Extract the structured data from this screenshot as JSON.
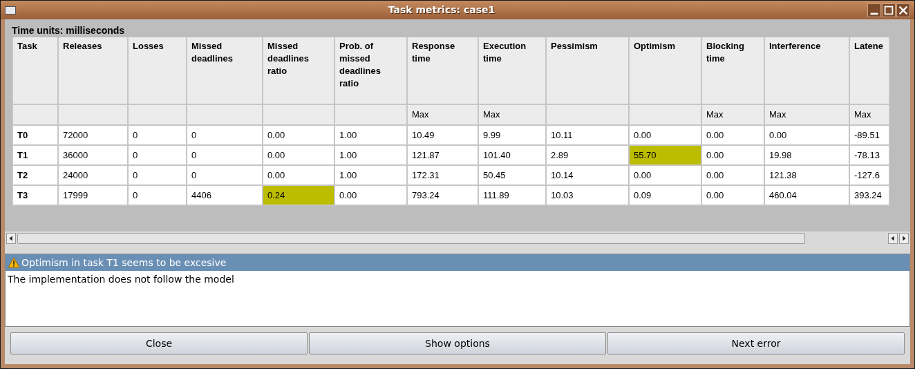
{
  "window": {
    "title": "Task metrics: case1"
  },
  "time_units": "Time units: milliseconds",
  "table": {
    "columns": [
      {
        "label": "Task"
      },
      {
        "label": "Releases"
      },
      {
        "label": "Losses"
      },
      {
        "label": "Missed deadlines"
      },
      {
        "label": "Missed deadlines ratio"
      },
      {
        "label": "Prob. of missed deadlines ratio"
      },
      {
        "label": "Response time",
        "sub": "Max"
      },
      {
        "label": "Execution time",
        "sub": "Max"
      },
      {
        "label": "Pessimism"
      },
      {
        "label": "Optimism"
      },
      {
        "label": "Blocking time",
        "sub": "Max"
      },
      {
        "label": "Interference",
        "sub": "Max"
      },
      {
        "label": "Latene",
        "sub": "Max"
      }
    ],
    "rows": [
      {
        "cells": [
          {
            "text": "T0",
            "highlighted": false
          },
          {
            "text": "72000",
            "highlighted": false
          },
          {
            "text": "0",
            "highlighted": false
          },
          {
            "text": "0",
            "highlighted": false
          },
          {
            "text": "0.00",
            "highlighted": false
          },
          {
            "text": "1.00",
            "highlighted": false
          },
          {
            "text": "10.49",
            "highlighted": false
          },
          {
            "text": "9.99",
            "highlighted": false
          },
          {
            "text": "10.11",
            "highlighted": false
          },
          {
            "text": "0.00",
            "highlighted": false
          },
          {
            "text": "0.00",
            "highlighted": false
          },
          {
            "text": "0.00",
            "highlighted": false
          },
          {
            "text": "-89.51",
            "highlighted": false
          }
        ]
      },
      {
        "cells": [
          {
            "text": "T1",
            "highlighted": false
          },
          {
            "text": "36000",
            "highlighted": false
          },
          {
            "text": "0",
            "highlighted": false
          },
          {
            "text": "0",
            "highlighted": false
          },
          {
            "text": "0.00",
            "highlighted": false
          },
          {
            "text": "1.00",
            "highlighted": false
          },
          {
            "text": "121.87",
            "highlighted": false
          },
          {
            "text": "101.40",
            "highlighted": false
          },
          {
            "text": "2.89",
            "highlighted": false
          },
          {
            "text": "55.70",
            "highlighted": true
          },
          {
            "text": "0.00",
            "highlighted": false
          },
          {
            "text": "19.98",
            "highlighted": false
          },
          {
            "text": "-78.13",
            "highlighted": false
          }
        ]
      },
      {
        "cells": [
          {
            "text": "T2",
            "highlighted": false
          },
          {
            "text": "24000",
            "highlighted": false
          },
          {
            "text": "0",
            "highlighted": false
          },
          {
            "text": "0",
            "highlighted": false
          },
          {
            "text": "0.00",
            "highlighted": false
          },
          {
            "text": "1.00",
            "highlighted": false
          },
          {
            "text": "172.31",
            "highlighted": false
          },
          {
            "text": "50.45",
            "highlighted": false
          },
          {
            "text": "10.14",
            "highlighted": false
          },
          {
            "text": "0.00",
            "highlighted": false
          },
          {
            "text": "0.00",
            "highlighted": false
          },
          {
            "text": "121.38",
            "highlighted": false
          },
          {
            "text": "-127.6",
            "highlighted": false
          }
        ]
      },
      {
        "cells": [
          {
            "text": "T3",
            "highlighted": false
          },
          {
            "text": "17999",
            "highlighted": false
          },
          {
            "text": "0",
            "highlighted": false
          },
          {
            "text": "4406",
            "highlighted": false
          },
          {
            "text": "0.24",
            "highlighted": true
          },
          {
            "text": "0.00",
            "highlighted": false
          },
          {
            "text": "793.24",
            "highlighted": false
          },
          {
            "text": "111.89",
            "highlighted": false
          },
          {
            "text": "10.03",
            "highlighted": false
          },
          {
            "text": "0.09",
            "highlighted": false
          },
          {
            "text": "0.00",
            "highlighted": false
          },
          {
            "text": "460.04",
            "highlighted": false
          },
          {
            "text": "393.24",
            "highlighted": false
          }
        ]
      }
    ]
  },
  "messages": [
    {
      "kind": "warning",
      "text": "Optimism in task T1 seems to be excesive",
      "selected": true
    },
    {
      "kind": "info",
      "text": "The implementation does not follow the model",
      "selected": false
    }
  ],
  "buttons": [
    "Close",
    "Show options",
    "Next error"
  ]
}
